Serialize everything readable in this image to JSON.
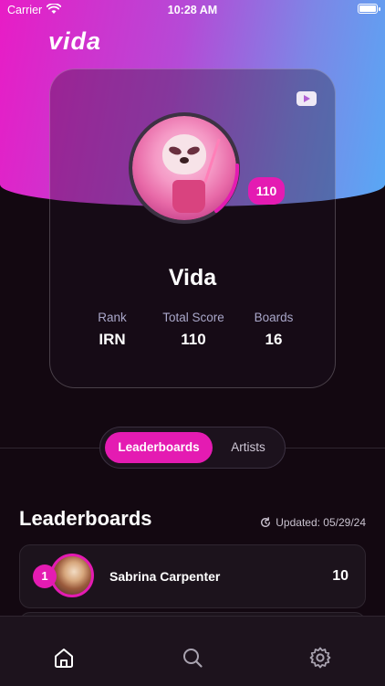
{
  "status_bar": {
    "carrier": "Carrier",
    "time": "10:28 AM"
  },
  "brand": {
    "logo_text": "vida"
  },
  "profile": {
    "name": "Vida",
    "score_badge": "110",
    "stats": [
      {
        "label": "Rank",
        "value": "IRN"
      },
      {
        "label": "Total Score",
        "value": "110"
      },
      {
        "label": "Boards",
        "value": "16"
      }
    ]
  },
  "segmented": {
    "active": "Leaderboards",
    "inactive": "Artists"
  },
  "leaderboards": {
    "title": "Leaderboards",
    "updated": "Updated: 05/29/24",
    "rows": [
      {
        "rank": "1",
        "name": "Sabrina Carpenter",
        "score": "10"
      }
    ]
  },
  "tab_bar": {
    "items": [
      "home-icon",
      "search-icon",
      "gear-icon"
    ]
  },
  "colors": {
    "accent": "#e41bb2",
    "background": "#130811",
    "gradient_start": "#e81cc6",
    "gradient_end": "#58a8f5"
  }
}
